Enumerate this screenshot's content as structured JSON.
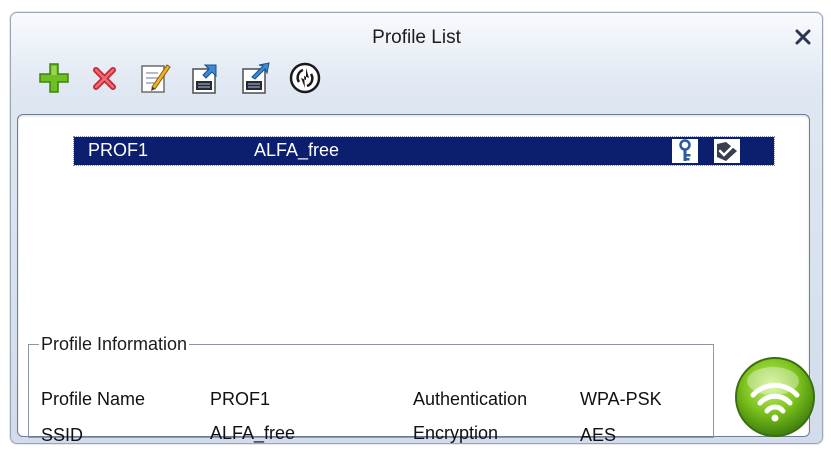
{
  "window": {
    "title": "Profile List"
  },
  "toolbar": {
    "buttons": [
      {
        "icon": "add-icon"
      },
      {
        "icon": "delete-icon"
      },
      {
        "icon": "edit-icon"
      },
      {
        "icon": "import-icon"
      },
      {
        "icon": "export-icon"
      },
      {
        "icon": "activate-icon"
      }
    ]
  },
  "profiles": [
    {
      "name": "PROF1",
      "ssid": "ALFA_free",
      "icons": [
        "key-icon",
        "connected-icon"
      ]
    }
  ],
  "profile_information": {
    "legend": "Profile Information",
    "profile_name_label": "Profile Name",
    "profile_name_value": "PROF1",
    "ssid_label": "SSID",
    "ssid_value": "ALFA_free",
    "authentication_label": "Authentication",
    "authentication_value": "WPA-PSK",
    "encryption_label": "Encryption",
    "encryption_value": "AES"
  },
  "colors": {
    "selection": "#0b1f6e",
    "accent_green": "#7dc21e",
    "delete_red": "#d0343c"
  }
}
